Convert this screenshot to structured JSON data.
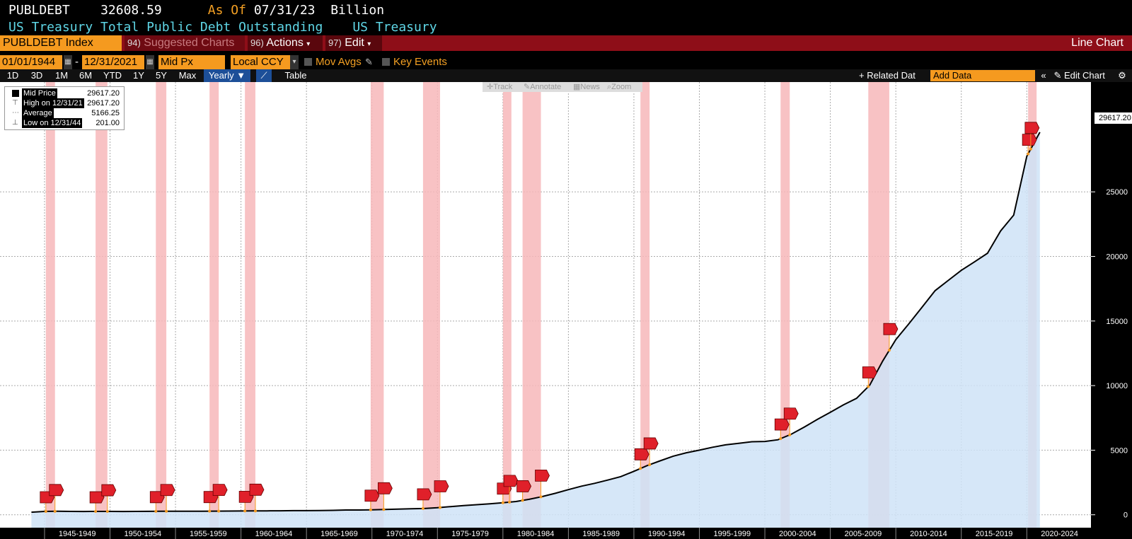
{
  "header": {
    "ticker": "PUBLDEBT",
    "last_value": "32608.59",
    "as_of_label": "As Of",
    "as_of_date": "07/31/23",
    "unit": "Billion",
    "description": "US Treasury Total Public Debt Outstanding",
    "source": "US Treasury"
  },
  "menubar": {
    "index_label": "PUBLDEBT Index",
    "suggested_num": "94)",
    "suggested_label": "Suggested Charts",
    "actions_num": "96)",
    "actions_label": "Actions",
    "edit_num": "97)",
    "edit_label": "Edit",
    "chart_type": "Line Chart"
  },
  "controls": {
    "start_date": "01/01/1944",
    "date_sep": "-",
    "end_date": "12/31/2021",
    "price_field": "Mid Px",
    "currency": "Local CCY",
    "mov_avgs": "Mov Avgs",
    "key_events": "Key Events"
  },
  "timeframes": [
    "1D",
    "3D",
    "1M",
    "6M",
    "YTD",
    "1Y",
    "5Y",
    "Max"
  ],
  "periodicity": "Yearly ▼",
  "table_label": "Table",
  "right_tools": {
    "related": "+ Related Dat",
    "add_data": "Add Data",
    "collapse": "«",
    "edit_chart": "Edit Chart"
  },
  "chart_tools": {
    "track": "Track",
    "annotate": "Annotate",
    "news": "News",
    "zoom": "Zoom"
  },
  "legend": {
    "mid_label": "Mid Price",
    "mid_value": "29617.20",
    "high_label": "High on 12/31/21",
    "high_value": "29617.20",
    "avg_label": "Average",
    "avg_value": "5166.25",
    "low_label": "Low on 12/31/44",
    "low_value": "201.00"
  },
  "last_label": "29617.20",
  "colors": {
    "line": "#000000",
    "area": "#cfe3f7",
    "recession": "#f7b7ba",
    "flag": "#e0202a",
    "menubar": "#8e0e18",
    "accent": "#f59a1f"
  },
  "chart_data": {
    "type": "area",
    "title": "",
    "xlabel": "",
    "ylabel": "",
    "ylim": [
      -1000,
      33500
    ],
    "yticks": [
      0,
      5000,
      10000,
      15000,
      20000,
      25000
    ],
    "x_period_labels": [
      "1945-1949",
      "1950-1954",
      "1955-1959",
      "1960-1964",
      "1965-1969",
      "1970-1974",
      "1975-1979",
      "1980-1984",
      "1985-1989",
      "1990-1994",
      "1995-1999",
      "2000-2004",
      "2005-2009",
      "2010-2014",
      "2015-2019",
      "2020-2024"
    ],
    "x": [
      1944,
      1945,
      1946,
      1947,
      1948,
      1949,
      1950,
      1951,
      1952,
      1953,
      1954,
      1955,
      1956,
      1957,
      1958,
      1959,
      1960,
      1961,
      1962,
      1963,
      1964,
      1965,
      1966,
      1967,
      1968,
      1969,
      1970,
      1971,
      1972,
      1973,
      1974,
      1975,
      1976,
      1977,
      1978,
      1979,
      1980,
      1981,
      1982,
      1983,
      1984,
      1985,
      1986,
      1987,
      1988,
      1989,
      1990,
      1991,
      1992,
      1993,
      1994,
      1995,
      1996,
      1997,
      1998,
      1999,
      2000,
      2001,
      2002,
      2003,
      2004,
      2005,
      2006,
      2007,
      2008,
      2009,
      2010,
      2011,
      2012,
      2013,
      2014,
      2015,
      2016,
      2017,
      2018,
      2019,
      2020,
      2021
    ],
    "series": [
      {
        "values": [
          201,
          260,
          271,
          257,
          252,
          257,
          257,
          255,
          259,
          266,
          271,
          274,
          273,
          272,
          280,
          287,
          290,
          296,
          303,
          310,
          318,
          322,
          329,
          341,
          369,
          368,
          383,
          410,
          437,
          468,
          486,
          544,
          632,
          706,
          780,
          845,
          930,
          1028,
          1197,
          1411,
          1663,
          1945,
          2214,
          2431,
          2684,
          2953,
          3364,
          3802,
          4177,
          4536,
          4800,
          5001,
          5225,
          5413,
          5526,
          5656,
          5674,
          5807,
          6228,
          6783,
          7379,
          7933,
          8507,
          9008,
          10025,
          11910,
          13562,
          14791,
          16066,
          17352,
          18141,
          18922,
          19573,
          20245,
          21974,
          23201,
          27748,
          29617
        ]
      }
    ],
    "recessions": [
      [
        1945.1,
        1945.8
      ],
      [
        1948.9,
        1949.8
      ],
      [
        1953.5,
        1954.3
      ],
      [
        1957.6,
        1958.3
      ],
      [
        1960.3,
        1961.1
      ],
      [
        1969.9,
        1970.9
      ],
      [
        1973.9,
        1975.2
      ],
      [
        1980.0,
        1980.5
      ],
      [
        1981.5,
        1982.9
      ],
      [
        1990.5,
        1991.2
      ],
      [
        2001.2,
        2001.9
      ],
      [
        2007.9,
        2009.5
      ],
      [
        2020.1,
        2020.3
      ]
    ],
    "grid": true
  }
}
